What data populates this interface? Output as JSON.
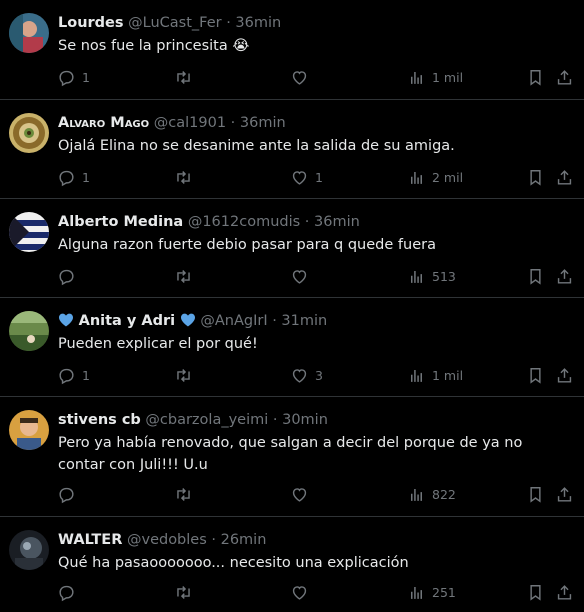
{
  "tweets": [
    {
      "name": "Lourdes",
      "handle": "@LuCast_Fer",
      "time": "36min",
      "text": "Se nos fue la princesita 😭",
      "replies": "1",
      "retweets": "",
      "likes": "",
      "views": "1 mil"
    },
    {
      "name": "Alvaro Mago",
      "handle": "@cal1901",
      "time": "36min",
      "text": "Ojalá Elina no se desanime ante la salida de su amiga.",
      "replies": "1",
      "retweets": "",
      "likes": "1",
      "views": "2 mil"
    },
    {
      "name": "Alberto Medina",
      "handle": "@1612comudis",
      "time": "36min",
      "text": "Alguna razon fuerte debio pasar para q quede fuera",
      "replies": "",
      "retweets": "",
      "likes": "",
      "views": "513"
    },
    {
      "name": "Anita y Adri",
      "handle": "@AnAgIrI",
      "time": "31min",
      "text": "Pueden explicar el por qué!",
      "replies": "1",
      "retweets": "",
      "likes": "3",
      "views": "1 mil"
    },
    {
      "name": "stivens cb",
      "handle": "@cbarzola_yeimi",
      "time": "30min",
      "text": "Pero ya había renovado, que salgan a decir del porque de ya no contar con Juli!!! U.u",
      "replies": "",
      "retweets": "",
      "likes": "",
      "views": "822"
    },
    {
      "name": "WALTER",
      "handle": "@vedobles",
      "time": "26min",
      "text": "Qué ha pasaooooooo... necesito una explicación",
      "replies": "",
      "retweets": "",
      "likes": "",
      "views": "251"
    }
  ],
  "separator": "·",
  "colors": {
    "background": "#000000",
    "text": "#e7e9ea",
    "muted": "#71767b",
    "border": "#2f3336",
    "heart_blue": "#5ba4e6"
  },
  "icons": [
    "reply-icon",
    "retweet-icon",
    "like-icon",
    "views-icon",
    "bookmark-icon",
    "share-icon"
  ]
}
